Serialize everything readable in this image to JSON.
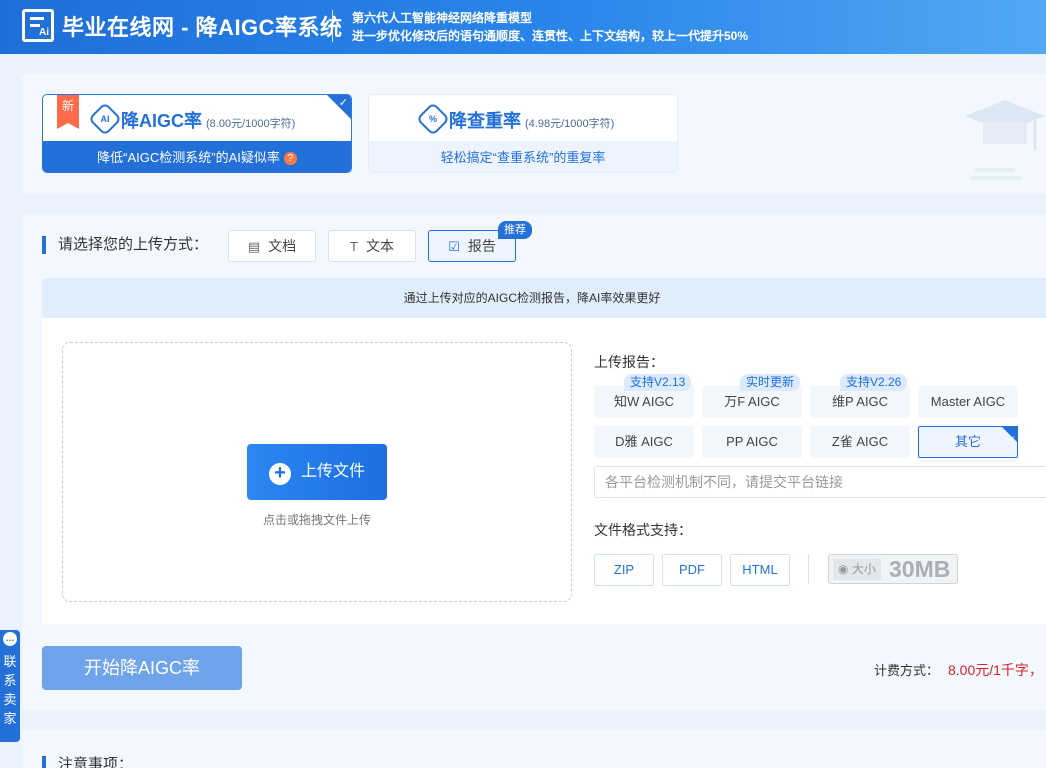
{
  "header": {
    "site_title": "毕业在线网 - 降AIGC率系统",
    "subtitle_line1": "第六代人工智能神经网络降重模型",
    "subtitle_line2": "进一步优化修改后的语句通顺度、连贯性、上下文结构，较上一代提升50%",
    "logo_text": "Ai"
  },
  "services": [
    {
      "title": "降AIGC率",
      "price": "(8.00元/1000字符)",
      "description": "降低“AIGC检测系统”的AI疑似率",
      "badge": "新",
      "selected": true,
      "icon": "ai-diamond-icon"
    },
    {
      "title": "降查重率",
      "price": "(4.98元/1000字符)",
      "description": "轻松搞定“查重系统”的重复率",
      "selected": false,
      "icon": "percent-diamond-icon"
    }
  ],
  "upload_method": {
    "label": "请选择您的上传方式：",
    "options": [
      {
        "label": "文档",
        "icon": "document-icon"
      },
      {
        "label": "文本",
        "icon": "text-icon"
      },
      {
        "label": "报告",
        "icon": "report-icon",
        "selected": true,
        "badge": "推荐"
      }
    ]
  },
  "info_banner": "通过上传对应的AIGC检测报告，降AI率效果更好",
  "upload": {
    "button_label": "上传文件",
    "hint": "点击或拖拽文件上传"
  },
  "report": {
    "label": "上传报告：",
    "platforms": [
      {
        "label": "知W AIGC",
        "tag": "支持V2.13"
      },
      {
        "label": "万F AIGC",
        "tag": "实时更新"
      },
      {
        "label": "维P AIGC",
        "tag": "支持V2.26"
      },
      {
        "label": "Master AIGC",
        "tag": ""
      },
      {
        "label": "D雅 AIGC",
        "tag": ""
      },
      {
        "label": "PP AIGC",
        "tag": ""
      },
      {
        "label": "Z雀 AIGC",
        "tag": ""
      },
      {
        "label": "其它",
        "tag": "",
        "selected": true
      }
    ],
    "link_placeholder": "各平台检测机制不同，请提交平台链接"
  },
  "formats": {
    "label": "文件格式支持：",
    "items": [
      "ZIP",
      "PDF",
      "HTML"
    ],
    "size_label": "大小",
    "size_value": "30MB"
  },
  "actions": {
    "start_label": "开始降AIGC率",
    "fee_label": "计费方式：",
    "fee_value": "8.00元/1千字，"
  },
  "notes": {
    "label": "注意事项："
  },
  "contact": {
    "label": "联系卖家"
  },
  "colors": {
    "primary": "#2370d9",
    "accent": "#ff6b4a",
    "price": "#d4232b",
    "background": "#eaf3fd"
  }
}
